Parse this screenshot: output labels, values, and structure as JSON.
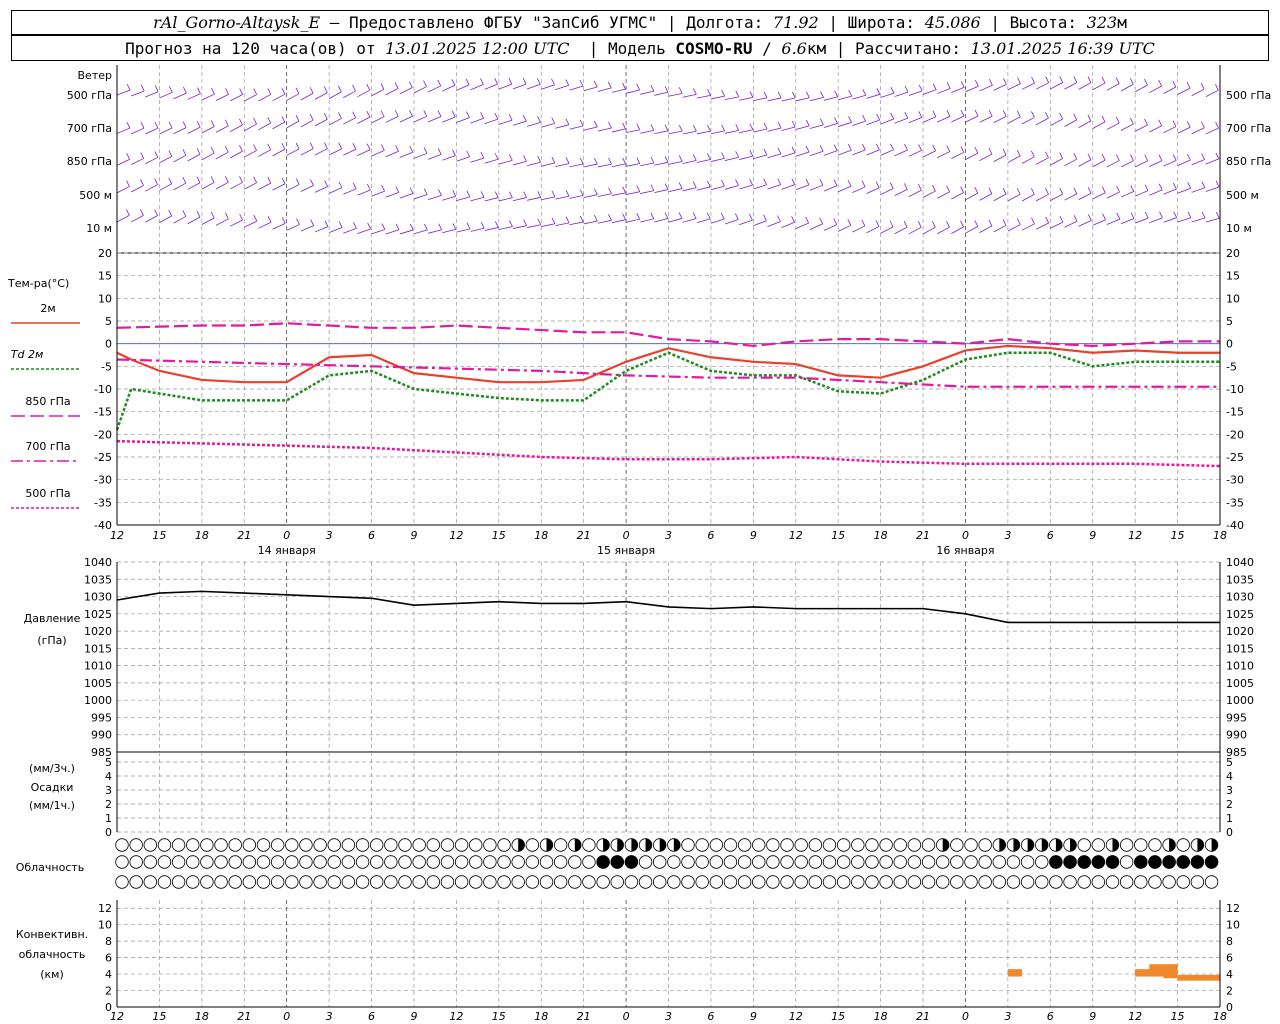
{
  "header": {
    "station": "rAl_Gorno-Altaysk_E",
    "provided_by": "– Предоставлено ФГБУ \"ЗапСиб УГМС\"",
    "lon_label": "Долгота:",
    "lon": "71.92",
    "lat_label": "Широта:",
    "lat": "45.086",
    "alt_label": "Высота:",
    "alt": "323",
    "alt_unit": "м",
    "forecast_label": "Прогноз на 120 часа(ов) от",
    "run_time": "13.01.2025 12:00 UTC",
    "model_label": "Модель",
    "model": "COSMO-RU",
    "resolution": "6.6",
    "res_unit": "км",
    "calc_label": "Рассчитано:",
    "calc_time": "13.01.2025 16:39 UTC"
  },
  "chart_data": {
    "type": "line",
    "x_hours_from_run": [
      0,
      78
    ],
    "time_ticks": [
      "12",
      "15",
      "18",
      "21",
      "0",
      "3",
      "6",
      "9",
      "12",
      "15",
      "18",
      "21",
      "0",
      "3",
      "6",
      "9",
      "12",
      "15",
      "18",
      "21",
      "0",
      "3",
      "6",
      "9",
      "12",
      "15",
      "18"
    ],
    "dates": [
      "14 января",
      "15 января",
      "16 января"
    ],
    "wind": {
      "title": "Ветер",
      "levels": [
        "500 гПа",
        "700 гПа",
        "850 гПа",
        "500 м",
        "10  м"
      ],
      "color": "#7a1fd4"
    },
    "temperature": {
      "title": "Тем-ра(°С)",
      "ylim": [
        -40,
        20
      ],
      "ticks": [
        20,
        15,
        10,
        5,
        0,
        -5,
        -10,
        -15,
        -20,
        -25,
        -30,
        -35,
        -40
      ],
      "legend": [
        "2м",
        "Td  2м",
        "850 гПа",
        "700 гПа",
        "500 гПа"
      ],
      "series": [
        {
          "name": "2м",
          "color": "#e8412c",
          "style": "solid",
          "x": [
            0,
            1,
            3,
            6,
            9,
            12,
            15,
            18,
            21,
            24,
            27,
            30,
            33,
            36,
            39,
            42,
            45,
            48,
            51,
            54,
            57,
            60,
            63,
            66,
            69,
            72,
            75,
            78
          ],
          "values": [
            -2,
            -3.5,
            -6,
            -8,
            -8.5,
            -8.5,
            -3,
            -2.5,
            -6.5,
            -7.5,
            -8.5,
            -8.5,
            -8,
            -4,
            -1,
            -3,
            -4,
            -4.5,
            -7,
            -7.5,
            -5,
            -1.5,
            -0.5,
            -1,
            -2,
            -1.5,
            -2,
            -2
          ]
        },
        {
          "name": "Td  2м",
          "color": "#1e8c1e",
          "style": "dotted",
          "x": [
            0,
            1,
            3,
            6,
            9,
            12,
            15,
            18,
            21,
            24,
            27,
            30,
            33,
            36,
            39,
            42,
            45,
            48,
            51,
            54,
            57,
            60,
            63,
            66,
            69,
            72,
            75,
            78
          ],
          "values": [
            -19,
            -10,
            -11,
            -12.5,
            -12.5,
            -12.5,
            -7,
            -6,
            -10,
            -11,
            -12,
            -12.5,
            -12.5,
            -6,
            -2,
            -6,
            -7,
            -7,
            -10.5,
            -11,
            -8,
            -3.5,
            -2,
            -2,
            -5,
            -4,
            -4,
            -4
          ]
        },
        {
          "name": "850 гПа",
          "color": "#e21aa0",
          "style": "longdash",
          "x": [
            0,
            6,
            9,
            12,
            15,
            18,
            21,
            24,
            27,
            30,
            33,
            36,
            39,
            42,
            45,
            48,
            51,
            54,
            57,
            60,
            63,
            66,
            69,
            72,
            75,
            78
          ],
          "values": [
            3.5,
            4,
            4,
            4.5,
            4,
            3.5,
            3.5,
            4,
            3.5,
            3,
            2.5,
            2.5,
            1,
            0.5,
            -0.5,
            0.5,
            1,
            1,
            0.5,
            0,
            1,
            0,
            -0.5,
            0,
            0.5,
            0.5
          ]
        },
        {
          "name": "700 гПа",
          "color": "#e21aa0",
          "style": "dashdot",
          "x": [
            0,
            6,
            12,
            18,
            24,
            30,
            36,
            42,
            48,
            54,
            60,
            66,
            72,
            78
          ],
          "values": [
            -3.5,
            -4,
            -4.5,
            -5,
            -5.5,
            -6,
            -7,
            -7.5,
            -7.5,
            -8.5,
            -9.5,
            -9.5,
            -9.5,
            -9.5
          ]
        },
        {
          "name": "500 гПа",
          "color": "#e21aa0",
          "style": "dotted",
          "x": [
            0,
            6,
            12,
            18,
            24,
            30,
            36,
            42,
            48,
            54,
            60,
            66,
            72,
            78
          ],
          "values": [
            -21.5,
            -22,
            -22.5,
            -23,
            -24,
            -25,
            -25.5,
            -25.5,
            -25,
            -26,
            -26.5,
            -26.5,
            -26.5,
            -27
          ]
        }
      ]
    },
    "pressure": {
      "title": "Давление",
      "unit": "(гПа)",
      "ylim": [
        985,
        1040
      ],
      "ticks": [
        1040,
        1035,
        1030,
        1025,
        1020,
        1015,
        1010,
        1005,
        1000,
        995,
        990,
        985
      ],
      "x": [
        0,
        3,
        6,
        9,
        12,
        15,
        18,
        21,
        24,
        27,
        30,
        33,
        36,
        39,
        42,
        45,
        48,
        51,
        54,
        57,
        60,
        63,
        66,
        69,
        72,
        75,
        78
      ],
      "values": [
        1029,
        1031,
        1031.5,
        1031,
        1030.5,
        1030,
        1029.5,
        1027.5,
        1028,
        1028.5,
        1028,
        1028,
        1028.5,
        1027,
        1026.5,
        1027,
        1026.5,
        1026.5,
        1026.5,
        1026.5,
        1025,
        1022.5,
        1022.5,
        1022.5,
        1022.5,
        1022.5,
        1022.5
      ],
      "color": "#000000"
    },
    "precip": {
      "unit1": "(мм/3ч.)",
      "title": "Осадки",
      "unit2": "(мм/1ч.)",
      "ylim": [
        0,
        5
      ],
      "ticks": [
        5,
        4,
        3,
        2,
        1,
        0
      ]
    },
    "clouds": {
      "title": "Облачность",
      "rows": 3,
      "count": 78
    },
    "convective": {
      "title": "Конвективн.",
      "title2": "облачность",
      "unit": "(км)",
      "ylim": [
        0,
        13
      ],
      "ticks": [
        12,
        10,
        8,
        6,
        4,
        2,
        0
      ],
      "color": "#f0882c"
    }
  }
}
